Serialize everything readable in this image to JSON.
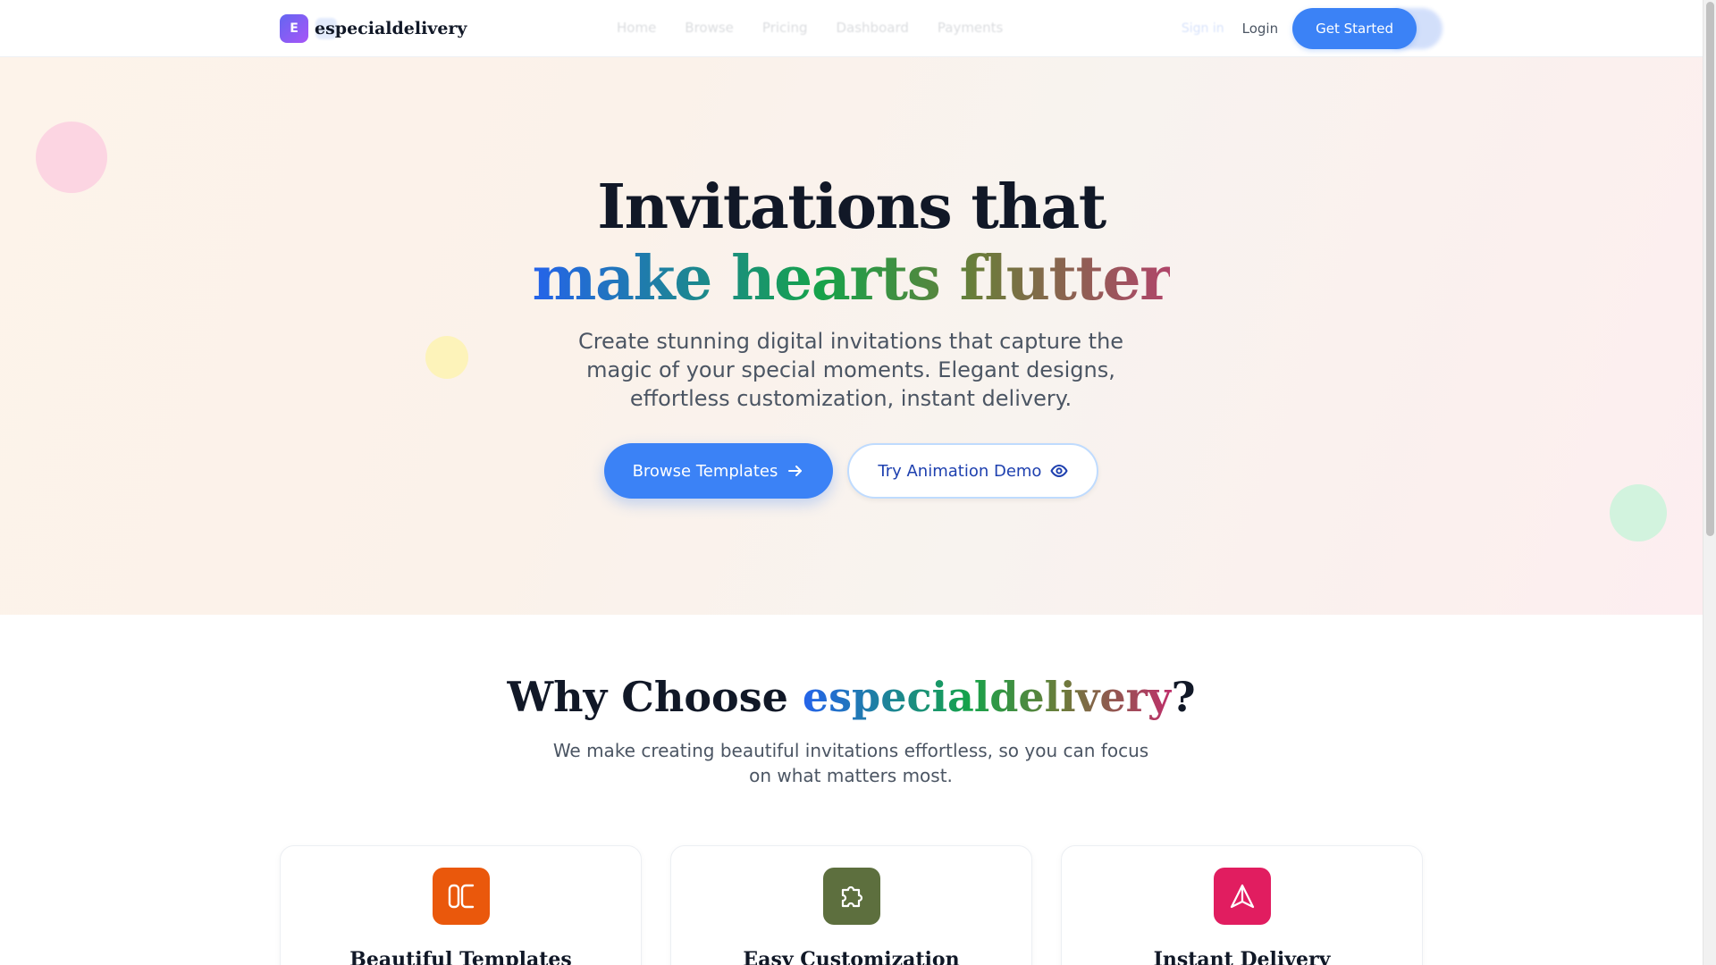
{
  "brand": {
    "logo_letter": "E",
    "name": "especialdelivery"
  },
  "nav": {
    "links": [
      "Home",
      "Browse",
      "Pricing",
      "Dashboard",
      "Payments"
    ],
    "sign_in": "Sign in",
    "login": "Login",
    "get_started": "Get Started"
  },
  "hero": {
    "title_line1": "Invitations that",
    "title_line2": "make hearts flutter",
    "subtitle": "Create stunning digital invitations that capture the magic of your special moments. Elegant designs, effortless customization, instant delivery.",
    "browse_button": "Browse Templates",
    "demo_button": "Try Animation Demo"
  },
  "features": {
    "title_prefix": "Why Choose ",
    "title_brand": "especialdelivery",
    "title_suffix": "?",
    "subtitle": "We make creating beautiful invitations effortless, so you can focus on what matters most.",
    "cards": [
      {
        "title": "Beautiful Templates",
        "icon": "template-icon",
        "color": "#ea580c"
      },
      {
        "title": "Easy Customization",
        "icon": "puzzle-icon",
        "color": "#5d6f3e"
      },
      {
        "title": "Instant Delivery",
        "icon": "send-icon",
        "color": "#e11d60"
      }
    ]
  },
  "colors": {
    "primary": "#3b82f6",
    "logo_gradient_start": "#6366f1",
    "logo_gradient_end": "#a855f7"
  }
}
